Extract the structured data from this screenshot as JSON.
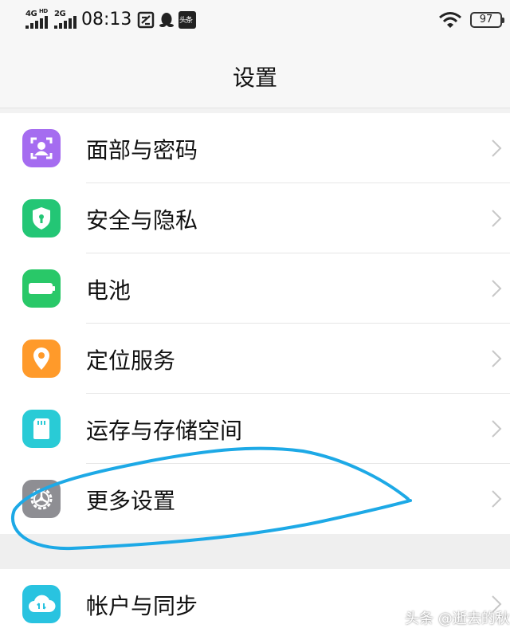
{
  "status_bar": {
    "sim1_network": "4G",
    "sim1_hd": "HD",
    "sim2_network": "2G",
    "time": "08:13",
    "battery_level": "97",
    "notification_icons": [
      "screenshot-icon",
      "qq-penguin-icon",
      "toutiao-icon"
    ],
    "toutiao_label": "头条"
  },
  "header": {
    "title": "设置"
  },
  "settings": {
    "items": [
      {
        "label": "面部与密码",
        "icon": "face-id-icon",
        "color": "#a56cf0"
      },
      {
        "label": "安全与隐私",
        "icon": "shield-icon",
        "color": "#23c675"
      },
      {
        "label": "电池",
        "icon": "battery-icon",
        "color": "#29c868"
      },
      {
        "label": "定位服务",
        "icon": "location-pin-icon",
        "color": "#ff9a2a"
      },
      {
        "label": "运存与存储空间",
        "icon": "sd-card-icon",
        "color": "#29cbd6"
      },
      {
        "label": "更多设置",
        "icon": "gear-icon",
        "color": "#8e8e93"
      }
    ],
    "group2": [
      {
        "label": "帐户与同步",
        "icon": "cloud-sync-icon",
        "color": "#29c3e0"
      }
    ]
  },
  "watermark": "头条 @逝去的秋",
  "annotation_color": "#1da9e6"
}
